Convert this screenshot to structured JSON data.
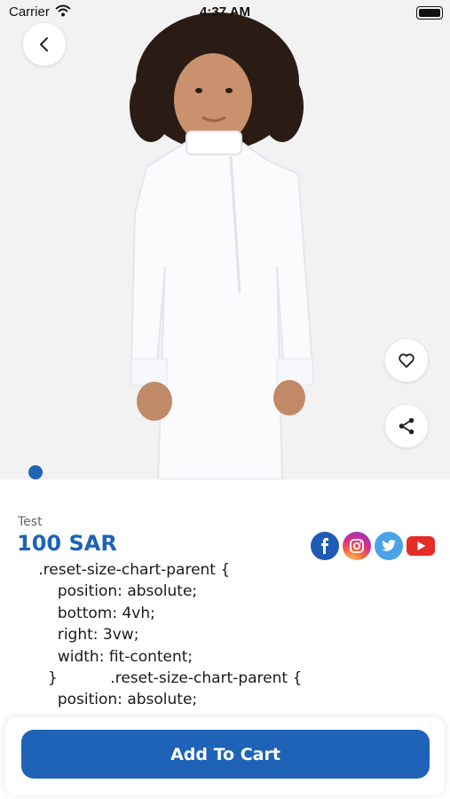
{
  "status_bar": {
    "carrier": "Carrier",
    "time": "4:37 AM"
  },
  "product": {
    "name": "Test",
    "price": "100 SAR",
    "description_lines": [
      "        .reset-size-chart-parent {",
      "            position: absolute;",
      "            bottom: 4vh;",
      "            right: 3vw;",
      "            width: fit-content;",
      "          }           .reset-size-chart-parent {",
      "            position: absolute;"
    ]
  },
  "image_carousel": {
    "active_index": 1,
    "total": 1
  },
  "icons": {
    "back": "chevron-left-icon",
    "favorite": "heart-icon",
    "share": "share-icon",
    "social": [
      "facebook-icon",
      "instagram-icon",
      "twitter-icon",
      "youtube-icon"
    ]
  },
  "actions": {
    "add_to_cart": "Add To Cart"
  },
  "colors": {
    "primary": "#1e63b8",
    "image_bg": "#f2f2f2"
  }
}
